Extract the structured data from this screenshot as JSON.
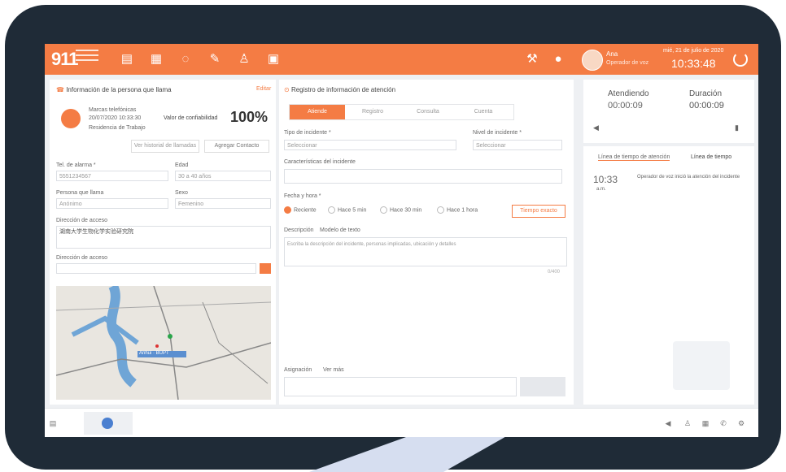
{
  "topbar": {
    "logo": "911",
    "user_name": "Ana",
    "user_role": "Operador de voz",
    "date": "mié, 21 de julio de 2020",
    "time": "10:33:48",
    "icons": [
      "document-icon",
      "document-check-icon",
      "whatsapp-icon",
      "edit-icon",
      "user-location-icon",
      "calendar-icon",
      "tools-icon",
      "bell-icon",
      "power-icon"
    ]
  },
  "caller": {
    "title": "Información de la persona que llama",
    "title_link": "Editar",
    "phone": "Marcas telefónicas",
    "datetime": "20/07/2020 10:33:30",
    "sub": "Residencia de Trabajo",
    "reliability_label": "Valor de confiabilidad",
    "reliability_value": "100%",
    "btn_history": "Ver historial de llamadas",
    "btn_contacts": "Agregar Contacto",
    "label_calltel": "Tel. de alarma *",
    "calltel_value": "5551234567",
    "label_age": "Edad",
    "age_value": "30 a 40 años",
    "label_person": "Persona que llama",
    "person_value": "Anónimo",
    "label_sex": "Sexo",
    "sex_value": "Femenino",
    "label_address": "Dirección de acceso",
    "address_value": "湖南大学生物化学实验研究院",
    "label_incident_addr": "Dirección de acceso",
    "map_label": "Anhui · BUPT"
  },
  "attention": {
    "title": "Registro de información de atención",
    "tabs": [
      "Atiende",
      "Registro",
      "Consulta",
      "Cuenta"
    ],
    "label_incident_type": "Tipo de incidente *",
    "incident_type_value": "Seleccionar",
    "label_priority": "Nivel de incidente *",
    "priority_value": "Seleccionar",
    "label_keywords": "Características del incidente",
    "label_datetime": "Fecha y hora *",
    "time_options": [
      "Reciente",
      "Hace 5 min",
      "Hace 30 min",
      "Hace 1 hora"
    ],
    "time_btn": "Tiempo exacto",
    "label_desc": "Descripción",
    "desc_hint": "Modelo de texto",
    "desc_placeholder": "Escriba la descripción del incidente, personas implicadas, ubicación y detalles",
    "desc_counter": "0/400",
    "label_attach": "Asignación",
    "attach_link": "Ver más"
  },
  "status": {
    "label_attending": "Atendiendo",
    "attending_value": "00:00:09",
    "label_duration": "Duración",
    "duration_value": "00:00:09"
  },
  "timeline": {
    "tab_active": "Línea de tiempo de atención",
    "tab_other": "Línea de tiempo",
    "entry_time": "10:33",
    "entry_ampm": "a.m.",
    "entry_text": "Operador de voz inició la atención del incidente"
  },
  "colors": {
    "accent": "#f47c44",
    "frame": "#1f2b37",
    "tail": "#d6def0"
  }
}
